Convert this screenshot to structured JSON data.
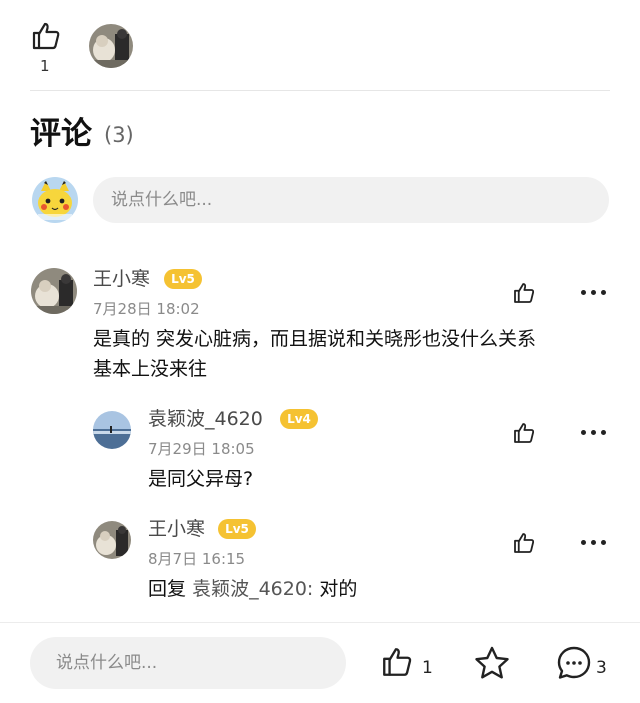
{
  "top_like": {
    "count": "1"
  },
  "comments_header": {
    "title": "评论",
    "count": "(3)"
  },
  "comment_input": {
    "placeholder": "说点什么吧..."
  },
  "comments": [
    {
      "author": "王小寒",
      "level": "Lv5",
      "time": "7月28日  18:02",
      "text_line1": "是真的 突发心脏病，而且据说和关晓彤也没什么关系",
      "text_line2": "基本上没来往"
    },
    {
      "author": "袁颖波_4620",
      "level": "Lv4",
      "time": "7月29日  18:05",
      "text": "是同父异母?"
    },
    {
      "author": "王小寒",
      "level": "Lv5",
      "time": "8月7日  16:15",
      "reply_prefix": "回复",
      "reply_to": "袁颖波_4620:",
      "text": "对的"
    }
  ],
  "bottom_bar": {
    "placeholder": "说点什么吧...",
    "like_count": "1",
    "comment_count": "3"
  },
  "colors": {
    "level_badge": "#f5c232",
    "input_bg": "#f1f1f1"
  }
}
